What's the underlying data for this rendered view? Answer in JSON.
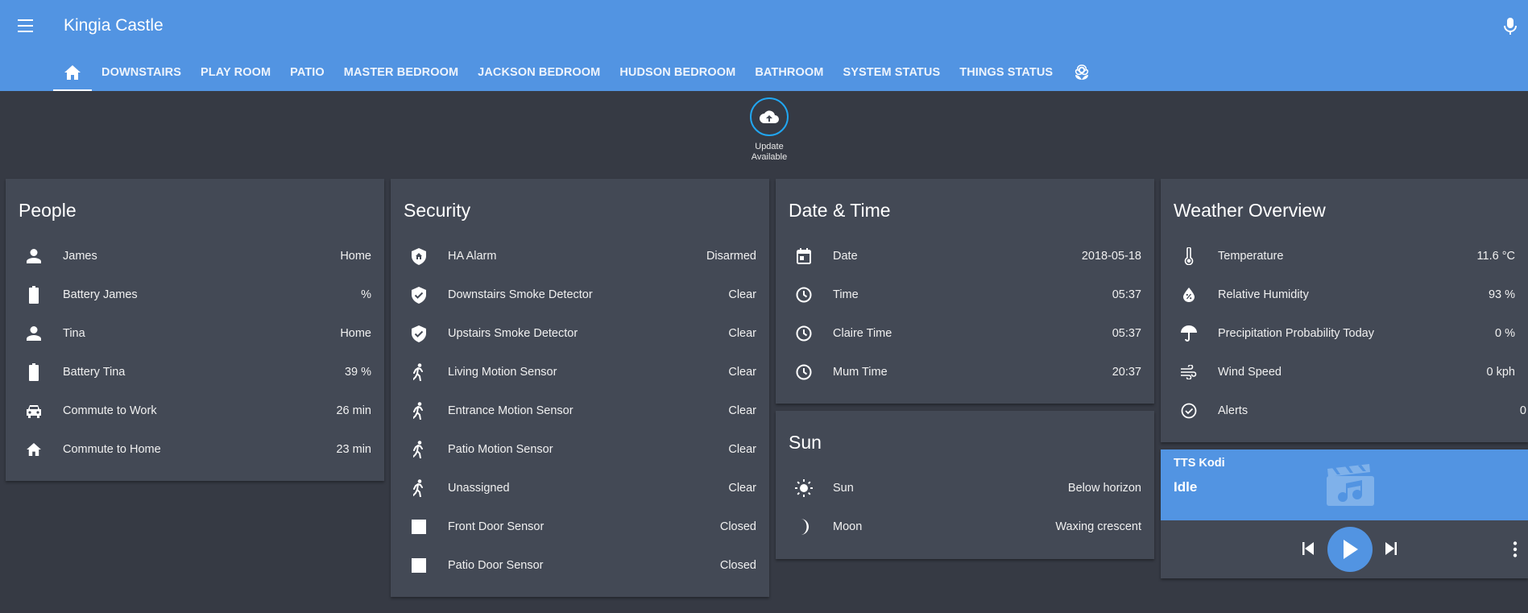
{
  "header": {
    "title": "Kingia Castle",
    "menu_icon": "menu-icon",
    "mic_icon": "microphone-icon",
    "tabs": [
      {
        "label": "DOWNSTAIRS"
      },
      {
        "label": "PLAY ROOM"
      },
      {
        "label": "PATIO"
      },
      {
        "label": "MASTER BEDROOM"
      },
      {
        "label": "JACKSON BEDROOM"
      },
      {
        "label": "HUDSON BEDROOM"
      },
      {
        "label": "BATHROOM"
      },
      {
        "label": "SYSTEM STATUS"
      },
      {
        "label": "THINGS STATUS"
      }
    ],
    "accent_color": "#5294e2"
  },
  "update": {
    "line1": "Update",
    "line2": "Available",
    "icon": "cloud-upload-icon"
  },
  "people": {
    "title": "People",
    "rows": [
      {
        "name": "James",
        "state": "Home",
        "icon": "person-icon"
      },
      {
        "name": "Battery James",
        "state": "%",
        "icon": "battery-icon"
      },
      {
        "name": "Tina",
        "state": "Home",
        "icon": "person-icon"
      },
      {
        "name": "Battery Tina",
        "state": "39 %",
        "icon": "battery-icon"
      },
      {
        "name": "Commute to Work",
        "state": "26 min",
        "icon": "car-icon"
      },
      {
        "name": "Commute to Home",
        "state": "23 min",
        "icon": "home-icon"
      }
    ]
  },
  "security": {
    "title": "Security",
    "rows": [
      {
        "name": "HA Alarm",
        "state": "Disarmed",
        "icon": "shield-home-icon"
      },
      {
        "name": "Downstairs Smoke Detector",
        "state": "Clear",
        "icon": "shield-check-icon"
      },
      {
        "name": "Upstairs Smoke Detector",
        "state": "Clear",
        "icon": "shield-check-icon"
      },
      {
        "name": "Living Motion Sensor",
        "state": "Clear",
        "icon": "walk-icon"
      },
      {
        "name": "Entrance Motion Sensor",
        "state": "Clear",
        "icon": "walk-icon"
      },
      {
        "name": "Patio Motion Sensor",
        "state": "Clear",
        "icon": "walk-icon"
      },
      {
        "name": "Unassigned",
        "state": "Clear",
        "icon": "walk-icon"
      },
      {
        "name": "Front Door Sensor",
        "state": "Closed",
        "icon": "square-icon"
      },
      {
        "name": "Patio Door Sensor",
        "state": "Closed",
        "icon": "square-icon"
      }
    ]
  },
  "datetime": {
    "title": "Date & Time",
    "rows": [
      {
        "name": "Date",
        "state": "2018-05-18",
        "icon": "calendar-icon"
      },
      {
        "name": "Time",
        "state": "05:37",
        "icon": "clock-icon"
      },
      {
        "name": "Claire Time",
        "state": "05:37",
        "icon": "clock-icon"
      },
      {
        "name": "Mum Time",
        "state": "20:37",
        "icon": "clock-icon"
      }
    ]
  },
  "sun": {
    "title": "Sun",
    "rows": [
      {
        "name": "Sun",
        "state": "Below horizon",
        "icon": "sun-icon"
      },
      {
        "name": "Moon",
        "state": "Waxing crescent",
        "icon": "moon-icon"
      }
    ]
  },
  "weather": {
    "title": "Weather Overview",
    "rows": [
      {
        "name": "Temperature",
        "state": "11.6 °C",
        "icon": "thermometer-icon"
      },
      {
        "name": "Relative Humidity",
        "state": "93 %",
        "icon": "water-percent-icon"
      },
      {
        "name": "Precipitation Probability Today",
        "state": "0 %",
        "icon": "umbrella-icon"
      },
      {
        "name": "Wind Speed",
        "state": "0 kph",
        "icon": "wind-icon"
      },
      {
        "name": "Alerts",
        "state": "0",
        "icon": "check-circle-icon"
      }
    ]
  },
  "media": {
    "name": "TTS Kodi",
    "state": "Idle",
    "art_icon": "movie-music-icon",
    "controls": [
      "previous-icon",
      "play-icon",
      "next-icon",
      "more-vertical-icon"
    ]
  }
}
